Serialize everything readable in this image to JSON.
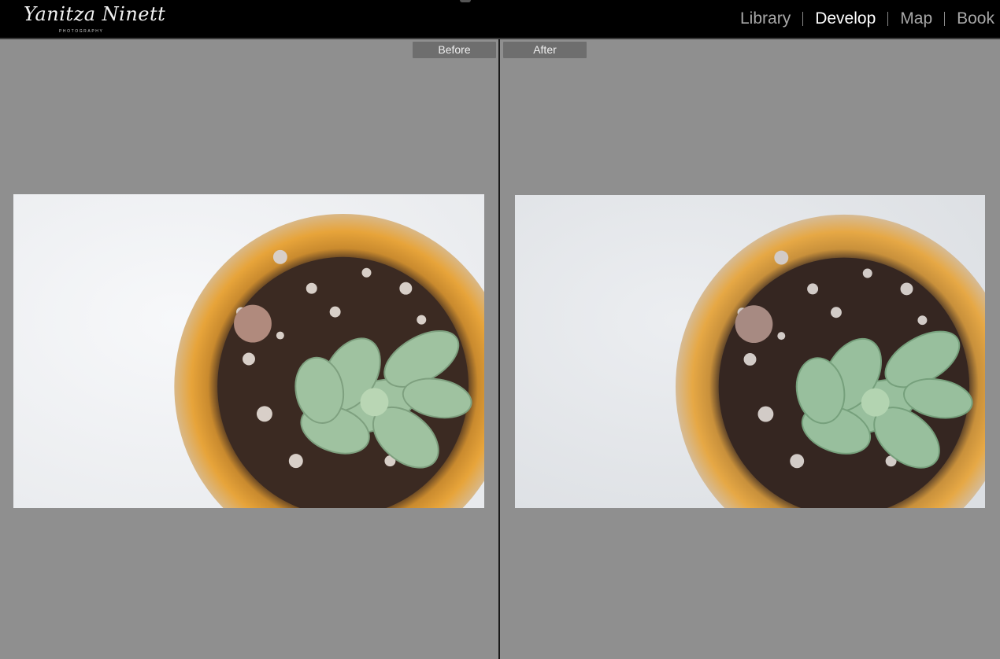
{
  "branding": {
    "logo_text": "Yanitza Ninett",
    "logo_subtext": "PHOTOGRAPHY"
  },
  "modules": [
    {
      "label": "Library",
      "active": false
    },
    {
      "label": "Develop",
      "active": true
    },
    {
      "label": "Map",
      "active": false
    },
    {
      "label": "Book",
      "active": false
    }
  ],
  "view": {
    "before_label": "Before",
    "after_label": "After"
  },
  "colors": {
    "topbar": "#000000",
    "canvas": "#8f8f8f",
    "tag_bg": "#6e6e6e",
    "active_module": "#ffffff",
    "inactive_module": "#a8a8a8"
  }
}
